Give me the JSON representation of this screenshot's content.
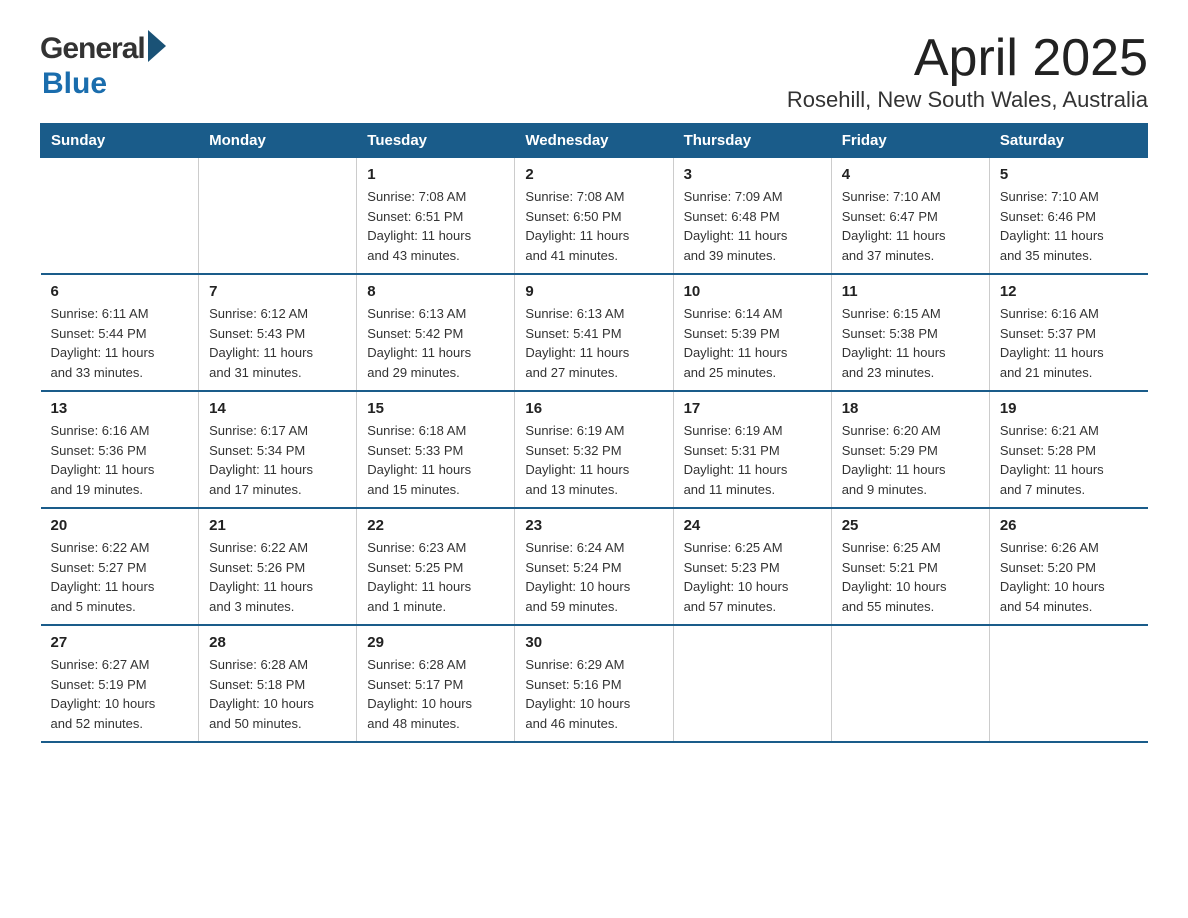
{
  "logo": {
    "general": "General",
    "blue": "Blue",
    "arrow": "▶"
  },
  "title": "April 2025",
  "subtitle": "Rosehill, New South Wales, Australia",
  "days_of_week": [
    "Sunday",
    "Monday",
    "Tuesday",
    "Wednesday",
    "Thursday",
    "Friday",
    "Saturday"
  ],
  "weeks": [
    [
      {
        "day": "",
        "info": ""
      },
      {
        "day": "",
        "info": ""
      },
      {
        "day": "1",
        "info": "Sunrise: 7:08 AM\nSunset: 6:51 PM\nDaylight: 11 hours\nand 43 minutes."
      },
      {
        "day": "2",
        "info": "Sunrise: 7:08 AM\nSunset: 6:50 PM\nDaylight: 11 hours\nand 41 minutes."
      },
      {
        "day": "3",
        "info": "Sunrise: 7:09 AM\nSunset: 6:48 PM\nDaylight: 11 hours\nand 39 minutes."
      },
      {
        "day": "4",
        "info": "Sunrise: 7:10 AM\nSunset: 6:47 PM\nDaylight: 11 hours\nand 37 minutes."
      },
      {
        "day": "5",
        "info": "Sunrise: 7:10 AM\nSunset: 6:46 PM\nDaylight: 11 hours\nand 35 minutes."
      }
    ],
    [
      {
        "day": "6",
        "info": "Sunrise: 6:11 AM\nSunset: 5:44 PM\nDaylight: 11 hours\nand 33 minutes."
      },
      {
        "day": "7",
        "info": "Sunrise: 6:12 AM\nSunset: 5:43 PM\nDaylight: 11 hours\nand 31 minutes."
      },
      {
        "day": "8",
        "info": "Sunrise: 6:13 AM\nSunset: 5:42 PM\nDaylight: 11 hours\nand 29 minutes."
      },
      {
        "day": "9",
        "info": "Sunrise: 6:13 AM\nSunset: 5:41 PM\nDaylight: 11 hours\nand 27 minutes."
      },
      {
        "day": "10",
        "info": "Sunrise: 6:14 AM\nSunset: 5:39 PM\nDaylight: 11 hours\nand 25 minutes."
      },
      {
        "day": "11",
        "info": "Sunrise: 6:15 AM\nSunset: 5:38 PM\nDaylight: 11 hours\nand 23 minutes."
      },
      {
        "day": "12",
        "info": "Sunrise: 6:16 AM\nSunset: 5:37 PM\nDaylight: 11 hours\nand 21 minutes."
      }
    ],
    [
      {
        "day": "13",
        "info": "Sunrise: 6:16 AM\nSunset: 5:36 PM\nDaylight: 11 hours\nand 19 minutes."
      },
      {
        "day": "14",
        "info": "Sunrise: 6:17 AM\nSunset: 5:34 PM\nDaylight: 11 hours\nand 17 minutes."
      },
      {
        "day": "15",
        "info": "Sunrise: 6:18 AM\nSunset: 5:33 PM\nDaylight: 11 hours\nand 15 minutes."
      },
      {
        "day": "16",
        "info": "Sunrise: 6:19 AM\nSunset: 5:32 PM\nDaylight: 11 hours\nand 13 minutes."
      },
      {
        "day": "17",
        "info": "Sunrise: 6:19 AM\nSunset: 5:31 PM\nDaylight: 11 hours\nand 11 minutes."
      },
      {
        "day": "18",
        "info": "Sunrise: 6:20 AM\nSunset: 5:29 PM\nDaylight: 11 hours\nand 9 minutes."
      },
      {
        "day": "19",
        "info": "Sunrise: 6:21 AM\nSunset: 5:28 PM\nDaylight: 11 hours\nand 7 minutes."
      }
    ],
    [
      {
        "day": "20",
        "info": "Sunrise: 6:22 AM\nSunset: 5:27 PM\nDaylight: 11 hours\nand 5 minutes."
      },
      {
        "day": "21",
        "info": "Sunrise: 6:22 AM\nSunset: 5:26 PM\nDaylight: 11 hours\nand 3 minutes."
      },
      {
        "day": "22",
        "info": "Sunrise: 6:23 AM\nSunset: 5:25 PM\nDaylight: 11 hours\nand 1 minute."
      },
      {
        "day": "23",
        "info": "Sunrise: 6:24 AM\nSunset: 5:24 PM\nDaylight: 10 hours\nand 59 minutes."
      },
      {
        "day": "24",
        "info": "Sunrise: 6:25 AM\nSunset: 5:23 PM\nDaylight: 10 hours\nand 57 minutes."
      },
      {
        "day": "25",
        "info": "Sunrise: 6:25 AM\nSunset: 5:21 PM\nDaylight: 10 hours\nand 55 minutes."
      },
      {
        "day": "26",
        "info": "Sunrise: 6:26 AM\nSunset: 5:20 PM\nDaylight: 10 hours\nand 54 minutes."
      }
    ],
    [
      {
        "day": "27",
        "info": "Sunrise: 6:27 AM\nSunset: 5:19 PM\nDaylight: 10 hours\nand 52 minutes."
      },
      {
        "day": "28",
        "info": "Sunrise: 6:28 AM\nSunset: 5:18 PM\nDaylight: 10 hours\nand 50 minutes."
      },
      {
        "day": "29",
        "info": "Sunrise: 6:28 AM\nSunset: 5:17 PM\nDaylight: 10 hours\nand 48 minutes."
      },
      {
        "day": "30",
        "info": "Sunrise: 6:29 AM\nSunset: 5:16 PM\nDaylight: 10 hours\nand 46 minutes."
      },
      {
        "day": "",
        "info": ""
      },
      {
        "day": "",
        "info": ""
      },
      {
        "day": "",
        "info": ""
      }
    ]
  ]
}
